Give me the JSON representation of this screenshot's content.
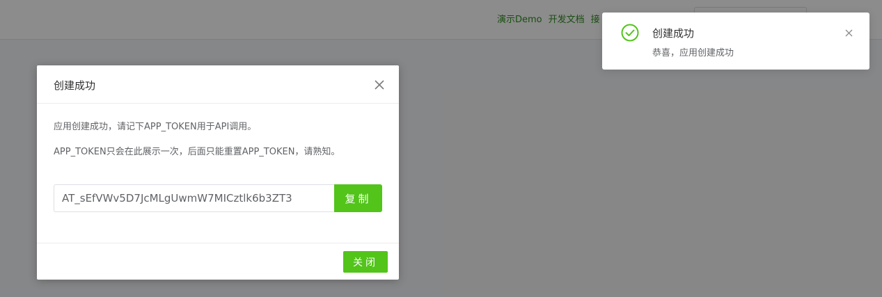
{
  "header": {
    "nav": [
      "演示Demo",
      "开发文档",
      "接"
    ]
  },
  "dialog": {
    "title": "创建成功",
    "close_icon": "close-icon",
    "message_line1": "应用创建成功，请记下APP_TOKEN用于API调用。",
    "message_line2": "APP_TOKEN只会在此展示一次，后面只能重置APP_TOKEN，请熟知。",
    "token_value": "AT_sEfVWv5D7JcMLgUwmW7MICztlk6b3ZT3",
    "copy_label": "复制",
    "close_label": "关闭"
  },
  "notification": {
    "icon": "success-check-icon",
    "title": "创建成功",
    "message": "恭喜，应用创建成功",
    "close_icon": "close-icon"
  },
  "colors": {
    "accent": "#52c41a",
    "nav_link": "#2f8f1f",
    "overlay": "rgba(0,0,0,0.45)"
  }
}
